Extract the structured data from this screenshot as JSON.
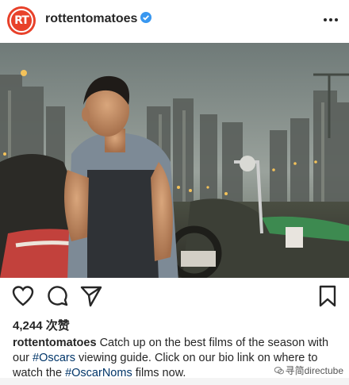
{
  "post": {
    "username": "rottentomatoes",
    "avatar_text": "RT",
    "likes": "4,244 次赞",
    "caption_user": "rottentomatoes",
    "caption_parts": [
      " Catch up on the best films of the season with our ",
      "#Oscars",
      " viewing guide. Click on our bio link on where to watch the ",
      "#OscarNoms",
      " films now."
    ]
  },
  "icons": {
    "verified": "verified-badge-icon",
    "more": "more-options-icon",
    "like": "heart-icon",
    "comment": "comment-icon",
    "share": "share-icon",
    "save": "bookmark-icon"
  },
  "watermark": {
    "text": "寻简directube"
  },
  "colors": {
    "brand": "#e8412a",
    "verified": "#3897f0",
    "hashtag": "#003569"
  }
}
